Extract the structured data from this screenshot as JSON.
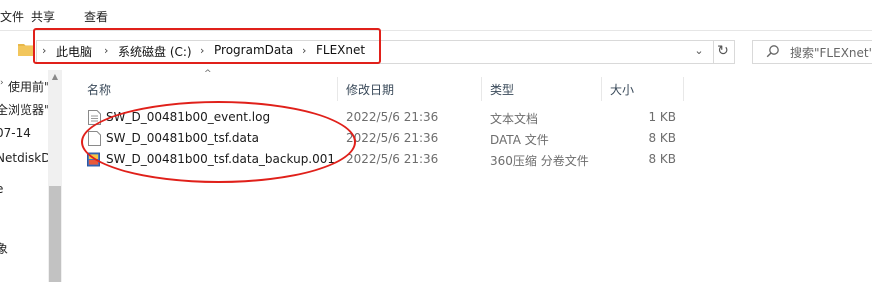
{
  "ribbon": {
    "tabs": [
      "文件",
      "共享",
      "查看"
    ]
  },
  "address": {
    "crumbs": [
      "此电脑",
      "系统磁盘 (C:)",
      "ProgramData",
      "FLEXnet"
    ]
  },
  "search": {
    "placeholder": "搜索\"FLEXnet\""
  },
  "nav_items": [
    "使用前\"",
    "全浏览器\"",
    "07-14",
    "NetdiskD",
    "e",
    "象"
  ],
  "columns": {
    "name": "名称",
    "modified": "修改日期",
    "type": "类型",
    "size": "大小"
  },
  "files": [
    {
      "name": "SW_D_00481b00_event.log",
      "modified": "2022/5/6 21:36",
      "type": "文本文档",
      "size": "1 KB",
      "icon": "text-file-icon"
    },
    {
      "name": "SW_D_00481b00_tsf.data",
      "modified": "2022/5/6 21:36",
      "type": "DATA 文件",
      "size": "8 KB",
      "icon": "blank-file-icon"
    },
    {
      "name": "SW_D_00481b00_tsf.data_backup.001",
      "modified": "2022/5/6 21:36",
      "type": "360压缩 分卷文件",
      "size": "8 KB",
      "icon": "archive-file-icon"
    }
  ],
  "colors": {
    "highlight": "#e0201a",
    "folder": "#e8b84a",
    "archive_blue": "#3a6fc4"
  }
}
